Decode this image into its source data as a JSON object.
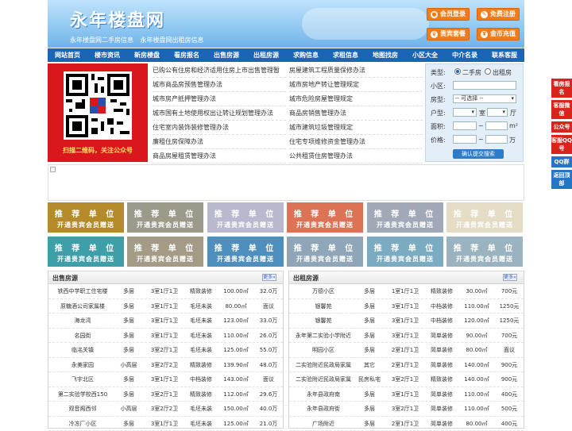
{
  "site": {
    "title": "永年楼盘网",
    "subtitle": "永年楼盘网二手房信息  永年楼盘网出租房信息"
  },
  "header_buttons": [
    {
      "label": "会员登录",
      "icon": "user-icon"
    },
    {
      "label": "免费注册",
      "icon": "pencil-icon"
    },
    {
      "label": "贵宾套餐",
      "icon": "crown-icon"
    },
    {
      "label": "金币充值",
      "icon": "coin-icon"
    }
  ],
  "nav": [
    "网站首页",
    "楼市资讯",
    "新房楼盘",
    "看房报名",
    "出售房源",
    "出租房源",
    "求购信息",
    "求租信息",
    "地图找房",
    "小区大全",
    "中介名录",
    "联系客服"
  ],
  "qr": {
    "caption": "扫描二维码，关注公众号"
  },
  "links_left": [
    "已购公有住房和经济适用住房上市出售管理暂",
    "城市商品房预售管理办法",
    "城市房产抵押管理办法",
    "城市国有土地使用权出让转让规划管理办法",
    "住宅室内装饰装修管理办法",
    "廉租住房保障办法",
    "商品房屋租赁管理办法"
  ],
  "links_right": [
    "房屋建筑工程质量保修办法",
    "城市房地产转让管理规定",
    "城市危险房屋管理规定",
    "商品房销售管理办法",
    "城市建筑垃圾管理规定",
    "住宅专项维修资金管理办法",
    "公共租赁住房管理办法"
  ],
  "search": {
    "type_label": "类型:",
    "opt_sale": "二手房",
    "opt_rent": "出租房",
    "area_label": "小区:",
    "house_label": "房型:",
    "house_select": "-- 可选择 --",
    "layout_label": "户型:",
    "room_unit": "室",
    "hall_unit": "厅",
    "size_label": "面积:",
    "size_sep": "~",
    "size_unit": "m²",
    "price_label": "价格:",
    "price_sep": "~",
    "price_unit": "万",
    "submit": "确认提交搜索"
  },
  "ad_tiles": {
    "line1": "推 荐 单 位",
    "line2": "开通贵宾会员赠送"
  },
  "sale_panel": {
    "title": "出售房源",
    "more": "更多»",
    "rows": [
      [
        "铁西中学职工住宅楼",
        "多层",
        "3室1厅1卫",
        "精致装修",
        "100.00㎡",
        "32.0万"
      ],
      [
        "原糖酒公司家属楼",
        "多层",
        "3室1厅1卫",
        "毛坯未装",
        "80.00㎡",
        "面议"
      ],
      [
        "海龙湾",
        "多层",
        "3室1厅1卫",
        "毛坯未装",
        "123.00㎡",
        "33.0万"
      ],
      [
        "名园街",
        "多层",
        "3室1厅1卫",
        "毛坯未装",
        "110.00㎡",
        "26.0万"
      ],
      [
        "临洺关镇",
        "多层",
        "3室2厅1卫",
        "毛坯未装",
        "125.00㎡",
        "55.0万"
      ],
      [
        "永美家园",
        "小高层",
        "3室2厅2卫",
        "精致装修",
        "139.90㎡",
        "48.0万"
      ],
      [
        "飞宇北区",
        "多层",
        "3室1厅1卫",
        "中档装修",
        "143.00㎡",
        "面议"
      ],
      [
        "第二实验学校西150",
        "多层",
        "3室2厅1卫",
        "精致装修",
        "112.00㎡",
        "29.6万"
      ],
      [
        "观音阁西邻",
        "小高层",
        "3室2厅2卫",
        "毛坯未装",
        "150.00㎡",
        "40.0万"
      ],
      [
        "冷冻厂小区",
        "多层",
        "3室1厅1卫",
        "毛坯未装",
        "125.00㎡",
        "21.0万"
      ]
    ]
  },
  "rent_panel": {
    "title": "出租房源",
    "more": "更多»",
    "rows": [
      [
        "万德小区",
        "多层",
        "1室1厅1卫",
        "精致装修",
        "30.00㎡",
        "700元"
      ],
      [
        "银馨苑",
        "多层",
        "3室1厅1卫",
        "中档装修",
        "110.00㎡",
        "1250元"
      ],
      [
        "银馨苑",
        "多层",
        "3室1厅1卫",
        "中档装修",
        "120.00㎡",
        "1250元"
      ],
      [
        "永年第二实验小学附近",
        "多层",
        "3室1厅1卫",
        "简单装修",
        "90.00㎡",
        "700元"
      ],
      [
        "明园小区",
        "多层",
        "2室1厅1卫",
        "简单装修",
        "80.00㎡",
        "面议"
      ],
      [
        "二实验附近民政局家属",
        "其它",
        "2室1厅1卫",
        "简单装修",
        "140.00㎡",
        "900元"
      ],
      [
        "二实验附近民政局家属",
        "民房私宅",
        "3室2厅1卫",
        "精致装修",
        "140.00㎡",
        "900元"
      ],
      [
        "永年县政府南",
        "多层",
        "3室1厅1卫",
        "简单装修",
        "110.00㎡",
        "400元"
      ],
      [
        "永年县政府街",
        "多层",
        "3室2厅1卫",
        "简单装修",
        "110.00㎡",
        "500元"
      ],
      [
        "广场附近",
        "多层",
        "2室1厅1卫",
        "简单装修",
        "80.00㎡",
        "400元"
      ]
    ]
  },
  "side_buttons": [
    "看房报名",
    "客服微信",
    "公众号",
    "客服QQ号",
    "QQ群",
    "返回顶部"
  ],
  "colors": {
    "nav": "#1b64b6",
    "orange": "#f07d1a",
    "qr_bg": "#d9171c",
    "tiles": [
      "#b58a2a",
      "#9c9a8a",
      "#b9b8ce",
      "#dd7355",
      "#a1a9b9",
      "#e4dcc5",
      "#3f9fa8",
      "#a39b85",
      "#4f8fbe",
      "#8fa6b8",
      "#7babc0",
      "#9bb3be"
    ]
  }
}
